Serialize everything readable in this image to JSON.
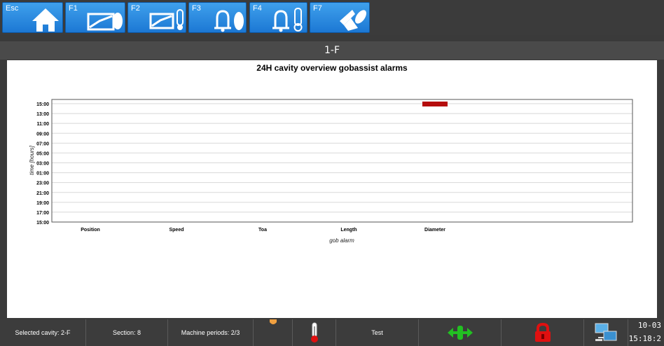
{
  "toolbar": {
    "keys": [
      {
        "label": "Esc",
        "icon": "home-icon"
      },
      {
        "label": "F1",
        "icon": "trend-chart-icon"
      },
      {
        "label": "F2",
        "icon": "trend-temperature-icon"
      },
      {
        "label": "F3",
        "icon": "alarm-bell-icon"
      },
      {
        "label": "F4",
        "icon": "alarm-temperature-icon"
      },
      {
        "label": "F7",
        "icon": "gob-shear-icon"
      }
    ]
  },
  "window": {
    "title": "1-F"
  },
  "chart_data": {
    "type": "heatmap",
    "title": "24H cavity overview gobassist alarms",
    "xlabel": "gob alarm",
    "ylabel": "time [hours]",
    "categories": [
      "Position",
      "Speed",
      "Toa",
      "Length",
      "Diameter"
    ],
    "y_ticks": [
      "15:00",
      "13:00",
      "11:00",
      "09:00",
      "07:00",
      "05:00",
      "03:00",
      "01:00",
      "23:00",
      "21:00",
      "19:00",
      "17:00",
      "15:00"
    ],
    "grid": true,
    "alarms": [
      {
        "category": "Diameter",
        "time": "15:00",
        "color": "#b50d0d"
      }
    ]
  },
  "status": {
    "selected_cavity": "Selected cavity: 2-F",
    "section": "Section: 8",
    "machine_periods": "Machine periods: 2/3",
    "test_label": "Test",
    "clock_top": "10-03",
    "clock_bottom": "15:18:2"
  },
  "icons": {
    "status": [
      "orange-indicator-icon",
      "thermometer-icon",
      "swab-arrows-icon",
      "lock-icon",
      "network-icon"
    ]
  },
  "colors": {
    "accent": "#1c78d4",
    "alarm": "#b50d0d",
    "lock": "#e01010",
    "swab": "#22c022"
  }
}
